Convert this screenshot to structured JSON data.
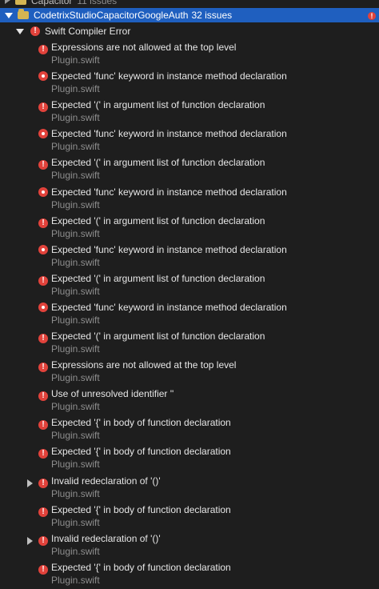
{
  "top_group": {
    "name": "Capacitor",
    "count": "11 issues"
  },
  "group": {
    "name": "CodetrixStudioCapacitorGoogleAuth",
    "count": "32 issues"
  },
  "section": {
    "title": "Swift Compiler Error"
  },
  "issues": [
    {
      "message": "Expressions are not allowed at the top level",
      "file": "Plugin.swift",
      "icon": "exclamation-icon",
      "expandable": false
    },
    {
      "message": "Expected 'func' keyword in instance method declaration",
      "file": "Plugin.swift",
      "icon": "dot-icon",
      "expandable": false
    },
    {
      "message": "Expected '(' in argument list of function declaration",
      "file": "Plugin.swift",
      "icon": "exclamation-icon",
      "expandable": false
    },
    {
      "message": "Expected 'func' keyword in instance method declaration",
      "file": "Plugin.swift",
      "icon": "dot-icon",
      "expandable": false
    },
    {
      "message": "Expected '(' in argument list of function declaration",
      "file": "Plugin.swift",
      "icon": "exclamation-icon",
      "expandable": false
    },
    {
      "message": "Expected 'func' keyword in instance method declaration",
      "file": "Plugin.swift",
      "icon": "dot-icon",
      "expandable": false
    },
    {
      "message": "Expected '(' in argument list of function declaration",
      "file": "Plugin.swift",
      "icon": "exclamation-icon",
      "expandable": false
    },
    {
      "message": "Expected 'func' keyword in instance method declaration",
      "file": "Plugin.swift",
      "icon": "dot-icon",
      "expandable": false
    },
    {
      "message": "Expected '(' in argument list of function declaration",
      "file": "Plugin.swift",
      "icon": "exclamation-icon",
      "expandable": false
    },
    {
      "message": "Expected 'func' keyword in instance method declaration",
      "file": "Plugin.swift",
      "icon": "dot-icon",
      "expandable": false
    },
    {
      "message": "Expected '(' in argument list of function declaration",
      "file": "Plugin.swift",
      "icon": "exclamation-icon",
      "expandable": false
    },
    {
      "message": "Expressions are not allowed at the top level",
      "file": "Plugin.swift",
      "icon": "exclamation-icon",
      "expandable": false
    },
    {
      "message": "Use of unresolved identifier ''",
      "file": "Plugin.swift",
      "icon": "exclamation-icon",
      "expandable": false
    },
    {
      "message": "Expected '{' in body of function declaration",
      "file": "Plugin.swift",
      "icon": "exclamation-icon",
      "expandable": false
    },
    {
      "message": "Expected '{' in body of function declaration",
      "file": "Plugin.swift",
      "icon": "exclamation-icon",
      "expandable": false
    },
    {
      "message": "Invalid redeclaration of '()'",
      "file": "Plugin.swift",
      "icon": "exclamation-icon",
      "expandable": true
    },
    {
      "message": "Expected '{' in body of function declaration",
      "file": "Plugin.swift",
      "icon": "exclamation-icon",
      "expandable": false
    },
    {
      "message": "Invalid redeclaration of '()'",
      "file": "Plugin.swift",
      "icon": "exclamation-icon",
      "expandable": true
    },
    {
      "message": "Expected '{' in body of function declaration",
      "file": "Plugin.swift",
      "icon": "exclamation-icon",
      "expandable": false
    }
  ],
  "colors": {
    "background": "#1e1e1e",
    "selection": "#1f5fbf",
    "error": "#e1423b",
    "secondary_text": "#8e8e8e"
  }
}
